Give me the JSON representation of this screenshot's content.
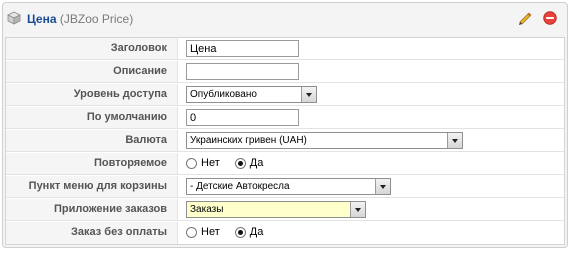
{
  "header": {
    "title": "Цена",
    "subtitle": "(JBZoo Price)",
    "icons": [
      "cube-icon",
      "pencil-icon",
      "delete-icon"
    ]
  },
  "rows": [
    {
      "label": "Заголовок",
      "type": "text",
      "value": "Цена"
    },
    {
      "label": "Описание",
      "type": "text",
      "value": ""
    },
    {
      "label": "Уровень доступа",
      "type": "select",
      "value": "Опубликовано"
    },
    {
      "label": "По умолчанию",
      "type": "text",
      "value": "0"
    },
    {
      "label": "Валюта",
      "type": "select",
      "value": "Украинских гривен (UAH)"
    },
    {
      "label": "Повторяемое",
      "type": "radio",
      "options": [
        "Нет",
        "Да"
      ],
      "selected": "Да"
    },
    {
      "label": "Пункт меню для корзины",
      "type": "select",
      "value": "- Детские Автокресла"
    },
    {
      "label": "Приложение заказов",
      "type": "select",
      "value": "Заказы"
    },
    {
      "label": "Заказ без оплаты",
      "type": "radio",
      "options": [
        "Нет",
        "Да"
      ],
      "selected": "Да"
    }
  ],
  "colors": {
    "title": "#1b4a93",
    "delete": "#e8433a",
    "highlight_select": "#ffffcc"
  }
}
